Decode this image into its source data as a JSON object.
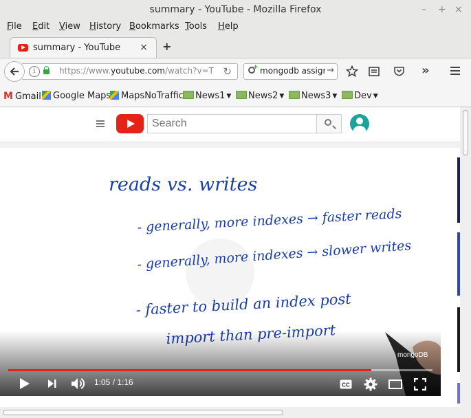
{
  "window": {
    "title": "summary - YouTube - Mozilla Firefox",
    "controls": [
      "–",
      "+",
      "×"
    ]
  },
  "menu": [
    "File",
    "Edit",
    "View",
    "History",
    "Bookmarks",
    "Tools",
    "Help"
  ],
  "menu_access_keys": [
    "F",
    "E",
    "V",
    "H",
    "B",
    "T",
    "H"
  ],
  "tab": {
    "title": "summary - YouTube",
    "close": "×",
    "new_tab": "+"
  },
  "nav": {
    "url": "https://www.youtube.com/watch?v=T",
    "url_prefix": "https://www.",
    "url_host": "youtube.com",
    "url_path": "/watch?v=T",
    "search_value": "mongodb assign",
    "search_go": "→"
  },
  "bookmarks": [
    {
      "label": "Gmail",
      "icon": "gmail-icon"
    },
    {
      "label": "Google Maps",
      "icon": "google-maps-icon"
    },
    {
      "label": "MapsNoTraffic",
      "icon": "google-maps-icon"
    },
    {
      "label": "News1",
      "icon": "folder-icon"
    },
    {
      "label": "News2",
      "icon": "folder-icon"
    },
    {
      "label": "News3",
      "icon": "folder-icon"
    },
    {
      "label": "Dev",
      "icon": "folder-icon"
    }
  ],
  "youtube": {
    "search_placeholder": "Search"
  },
  "video": {
    "current_time": "1:05",
    "duration": "1:16",
    "time_display": "1:05 / 1:16",
    "progress": 0.855,
    "watermark": "mongoDB",
    "whiteboard": {
      "title": "reads vs. writes",
      "lines": [
        "- generally, more indexes → faster reads",
        "- generally, more indexes → slower writes",
        "- faster to build an index post",
        "import than pre-import"
      ]
    }
  },
  "colors": {
    "youtube_red": "#e62117",
    "ink_blue": "#1b3ea8",
    "lock_green": "#2eab3f"
  }
}
